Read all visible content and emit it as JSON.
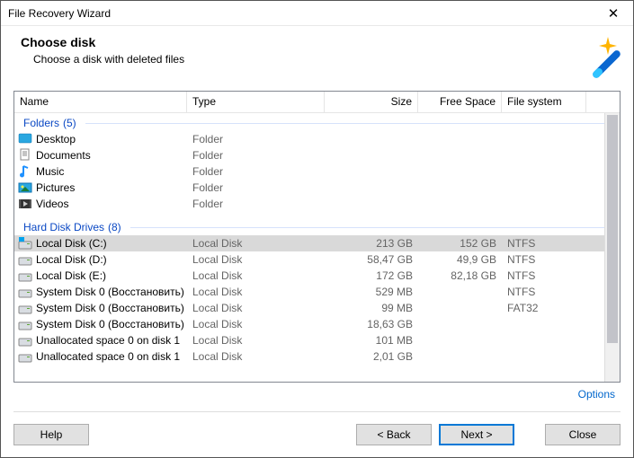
{
  "window": {
    "title": "File Recovery Wizard"
  },
  "header": {
    "title": "Choose disk",
    "subtitle": "Choose a disk with deleted files"
  },
  "columns": {
    "name": "Name",
    "type": "Type",
    "size": "Size",
    "free": "Free Space",
    "fs": "File system"
  },
  "groups": {
    "folders": {
      "label": "Folders",
      "count": "(5)"
    },
    "drives": {
      "label": "Hard Disk Drives",
      "count": "(8)"
    }
  },
  "folders": [
    {
      "name": "Desktop",
      "type": "Folder",
      "icon": "desktop"
    },
    {
      "name": "Documents",
      "type": "Folder",
      "icon": "documents"
    },
    {
      "name": "Music",
      "type": "Folder",
      "icon": "music"
    },
    {
      "name": "Pictures",
      "type": "Folder",
      "icon": "pictures"
    },
    {
      "name": "Videos",
      "type": "Folder",
      "icon": "videos"
    }
  ],
  "drives": [
    {
      "name": "Local Disk (C:)",
      "type": "Local Disk",
      "size": "213 GB",
      "free": "152 GB",
      "fs": "NTFS",
      "icon": "disk-win",
      "selected": true
    },
    {
      "name": "Local Disk (D:)",
      "type": "Local Disk",
      "size": "58,47 GB",
      "free": "49,9 GB",
      "fs": "NTFS",
      "icon": "disk"
    },
    {
      "name": "Local Disk (E:)",
      "type": "Local Disk",
      "size": "172 GB",
      "free": "82,18 GB",
      "fs": "NTFS",
      "icon": "disk"
    },
    {
      "name": "System Disk 0 (Восстановить)",
      "type": "Local Disk",
      "size": "529 MB",
      "free": "",
      "fs": "NTFS",
      "icon": "disk"
    },
    {
      "name": "System Disk 0 (Восстановить)",
      "type": "Local Disk",
      "size": "99 MB",
      "free": "",
      "fs": "FAT32",
      "icon": "disk"
    },
    {
      "name": "System Disk 0 (Восстановить)",
      "type": "Local Disk",
      "size": "18,63 GB",
      "free": "",
      "fs": "",
      "icon": "disk"
    },
    {
      "name": "Unallocated space 0 on disk 1",
      "type": "Local Disk",
      "size": "101 MB",
      "free": "",
      "fs": "",
      "icon": "disk"
    },
    {
      "name": "Unallocated space 0 on disk 1",
      "type": "Local Disk",
      "size": "2,01 GB",
      "free": "",
      "fs": "",
      "icon": "disk"
    }
  ],
  "links": {
    "options": "Options"
  },
  "buttons": {
    "help": "Help",
    "back": "< Back",
    "next": "Next >",
    "close": "Close"
  }
}
